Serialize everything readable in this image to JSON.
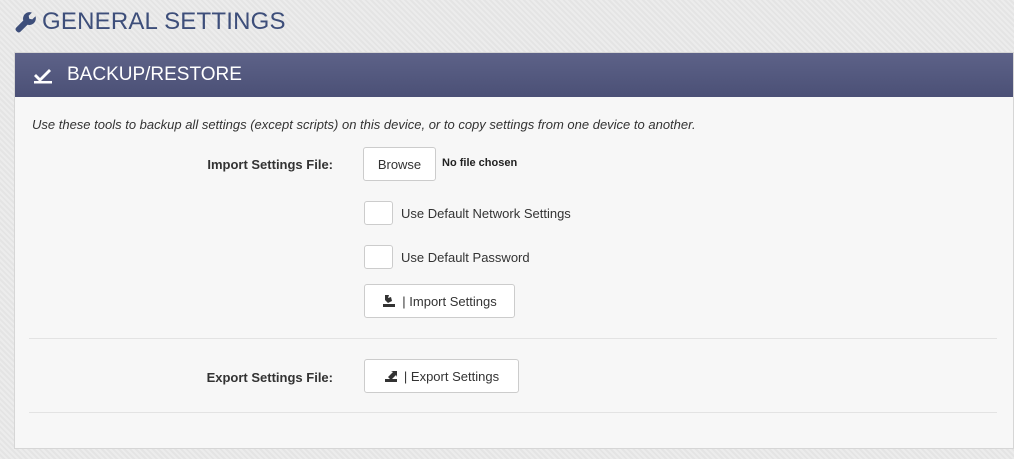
{
  "header": {
    "title": "GENERAL SETTINGS",
    "icon": "wrench-icon"
  },
  "panel": {
    "title": "BACKUP/RESTORE",
    "icon": "backup-restore-icon",
    "description": "Use these tools to backup all settings (except scripts) on this device, or to copy settings from one device to another."
  },
  "import": {
    "label": "Import Settings File:",
    "browse_label": "Browse",
    "file_status": "No file chosen",
    "default_network_label": "Use Default Network Settings",
    "default_network_checked": false,
    "default_password_label": "Use Default Password",
    "default_password_checked": false,
    "button_label": "| Import Settings",
    "button_icon": "import-icon"
  },
  "export": {
    "label": "Export Settings File:",
    "button_label": "| Export Settings",
    "button_icon": "export-icon"
  },
  "colors": {
    "heading_bg": "#4f5479",
    "title_text": "#3d4e7a"
  }
}
